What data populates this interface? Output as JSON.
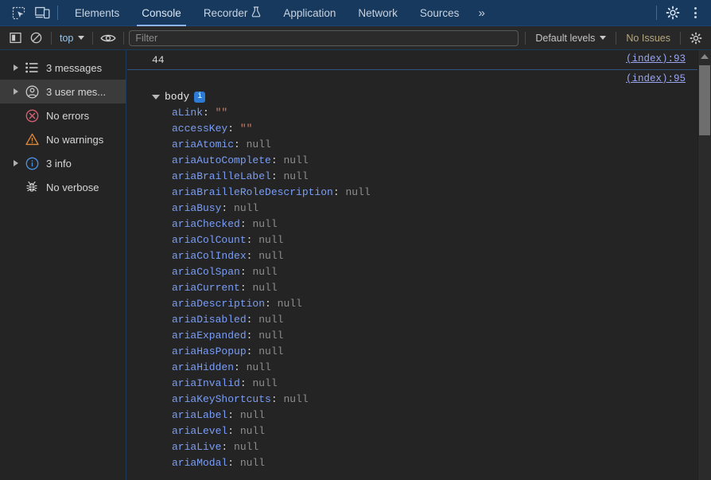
{
  "window": {
    "title": "Chrome DevTools — Console",
    "colors": {
      "tabbar_bg": "#17395e",
      "panel_bg": "#242424",
      "toolbar_bg": "#282828",
      "accent_underline": "#8ab4f8",
      "link": "#9aa6f0",
      "property_key": "#7a9df5",
      "null_value": "#8e8e8e",
      "string_value": "#c8826c",
      "issues_text": "#b5a780",
      "selected_row": "#3b3b3b",
      "divider_blue": "#2f5480"
    }
  },
  "tabbar": {
    "inspect_icon": "inspect-element-icon",
    "device_icon": "device-toolbar-icon",
    "tabs": [
      {
        "label": "Elements",
        "active": false,
        "badge": ""
      },
      {
        "label": "Console",
        "active": true,
        "badge": ""
      },
      {
        "label": "Recorder",
        "active": false,
        "badge": "flask-icon"
      },
      {
        "label": "Application",
        "active": false,
        "badge": ""
      },
      {
        "label": "Network",
        "active": false,
        "badge": ""
      },
      {
        "label": "Sources",
        "active": false,
        "badge": ""
      }
    ],
    "more_tabs": "»",
    "settings_icon": "gear-icon",
    "more_options_icon": "kebab-menu-icon"
  },
  "toolbar": {
    "sidebar_toggle_icon": "show-console-sidebar-icon",
    "clear_icon": "clear-console-icon",
    "context": "top",
    "eye_icon": "live-expression-eye-icon",
    "filter": {
      "value": "",
      "placeholder": "Filter"
    },
    "levels": "Default levels",
    "issues": "No Issues",
    "console_settings_icon": "console-settings-gear-icon"
  },
  "sidebar": {
    "items": [
      {
        "label": "3 messages",
        "icon": "list-icon",
        "expandable": true,
        "selected": false
      },
      {
        "label": "3 user mes...",
        "icon": "user-icon",
        "expandable": true,
        "selected": true
      },
      {
        "label": "No errors",
        "icon": "error-icon",
        "expandable": false,
        "selected": false
      },
      {
        "label": "No warnings",
        "icon": "warning-icon",
        "expandable": false,
        "selected": false
      },
      {
        "label": "3 info",
        "icon": "info-icon",
        "expandable": true,
        "selected": false
      },
      {
        "label": "No verbose",
        "icon": "bug-icon",
        "expandable": false,
        "selected": false
      }
    ]
  },
  "console": {
    "messages": [
      {
        "text": "44",
        "source": "(index):93"
      },
      {
        "text": "",
        "source": "(index):95"
      }
    ],
    "object": {
      "name": "body",
      "badge": "i",
      "expanded": true,
      "properties": [
        {
          "key": "aLink",
          "value": "\"\"",
          "type": "string"
        },
        {
          "key": "accessKey",
          "value": "\"\"",
          "type": "string"
        },
        {
          "key": "ariaAtomic",
          "value": "null",
          "type": "null"
        },
        {
          "key": "ariaAutoComplete",
          "value": "null",
          "type": "null"
        },
        {
          "key": "ariaBrailleLabel",
          "value": "null",
          "type": "null"
        },
        {
          "key": "ariaBrailleRoleDescription",
          "value": "null",
          "type": "null"
        },
        {
          "key": "ariaBusy",
          "value": "null",
          "type": "null"
        },
        {
          "key": "ariaChecked",
          "value": "null",
          "type": "null"
        },
        {
          "key": "ariaColCount",
          "value": "null",
          "type": "null"
        },
        {
          "key": "ariaColIndex",
          "value": "null",
          "type": "null"
        },
        {
          "key": "ariaColSpan",
          "value": "null",
          "type": "null"
        },
        {
          "key": "ariaCurrent",
          "value": "null",
          "type": "null"
        },
        {
          "key": "ariaDescription",
          "value": "null",
          "type": "null"
        },
        {
          "key": "ariaDisabled",
          "value": "null",
          "type": "null"
        },
        {
          "key": "ariaExpanded",
          "value": "null",
          "type": "null"
        },
        {
          "key": "ariaHasPopup",
          "value": "null",
          "type": "null"
        },
        {
          "key": "ariaHidden",
          "value": "null",
          "type": "null"
        },
        {
          "key": "ariaInvalid",
          "value": "null",
          "type": "null"
        },
        {
          "key": "ariaKeyShortcuts",
          "value": "null",
          "type": "null"
        },
        {
          "key": "ariaLabel",
          "value": "null",
          "type": "null"
        },
        {
          "key": "ariaLevel",
          "value": "null",
          "type": "null"
        },
        {
          "key": "ariaLive",
          "value": "null",
          "type": "null"
        },
        {
          "key": "ariaModal",
          "value": "null",
          "type": "null"
        }
      ]
    }
  }
}
